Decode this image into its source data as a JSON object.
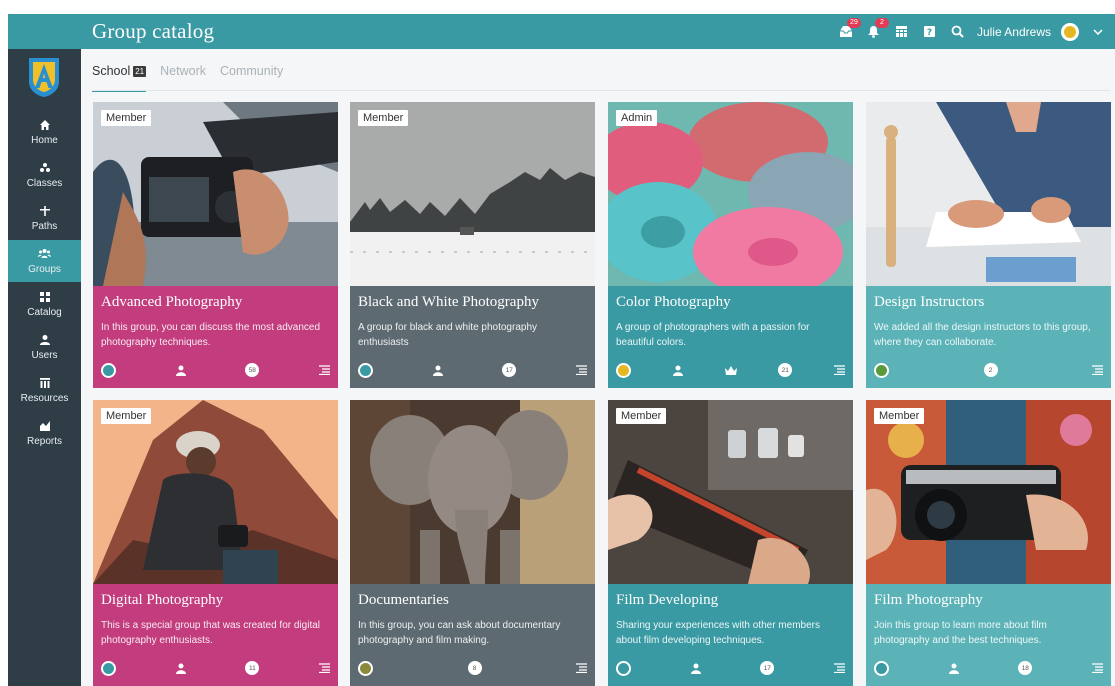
{
  "header": {
    "title": "Group catalog",
    "user_name": "Julie Andrews",
    "badges": {
      "notifications": "29",
      "alerts": "2"
    }
  },
  "sidebar": {
    "items": [
      {
        "label": "Home",
        "icon": "home-icon"
      },
      {
        "label": "Classes",
        "icon": "classes-icon"
      },
      {
        "label": "Paths",
        "icon": "paths-icon"
      },
      {
        "label": "Groups",
        "icon": "groups-icon",
        "active": true
      },
      {
        "label": "Catalog",
        "icon": "catalog-icon"
      },
      {
        "label": "Users",
        "icon": "users-icon"
      },
      {
        "label": "Resources",
        "icon": "resources-icon"
      },
      {
        "label": "Reports",
        "icon": "reports-icon"
      }
    ]
  },
  "tabs": [
    {
      "label": "School",
      "count": "21",
      "active": true
    },
    {
      "label": "Network"
    },
    {
      "label": "Community"
    }
  ],
  "cards": [
    {
      "role": "Member",
      "title": "Advanced Photography",
      "desc": "In this group, you can discuss the most advanced photography techniques.",
      "count": "58",
      "color": "#c23c7e"
    },
    {
      "role": "Member",
      "title": "Black and White Photography",
      "desc": "A group for black and white photography enthusiasts",
      "count": "17",
      "color": "#5d6a72"
    },
    {
      "role": "Admin",
      "title": "Color Photography",
      "desc": "A group of photographers with a passion for beautiful colors.",
      "count": "21",
      "color": "#3a9aa3"
    },
    {
      "role": "",
      "title": "Design Instructors",
      "desc": "We added all the design instructors to this group, where they can collaborate.",
      "count": "2",
      "color": "#5bb3b8"
    },
    {
      "role": "Member",
      "title": "Digital Photography",
      "desc": "This is a special group that was created for digital photography enthusiasts.",
      "count": "11",
      "color": "#c23c7e"
    },
    {
      "role": "",
      "title": "Documentaries",
      "desc": "In this group, you can ask about documentary photography and film making.",
      "count": "8",
      "color": "#5d6a72"
    },
    {
      "role": "Member",
      "title": "Film Developing",
      "desc": "Sharing your experiences with other members about film developing techniques.",
      "count": "17",
      "color": "#3a9aa3"
    },
    {
      "role": "Member",
      "title": "Film Photography",
      "desc": "Join this group to learn more about film photography and the best techniques.",
      "count": "18",
      "color": "#5bb3b8"
    }
  ]
}
